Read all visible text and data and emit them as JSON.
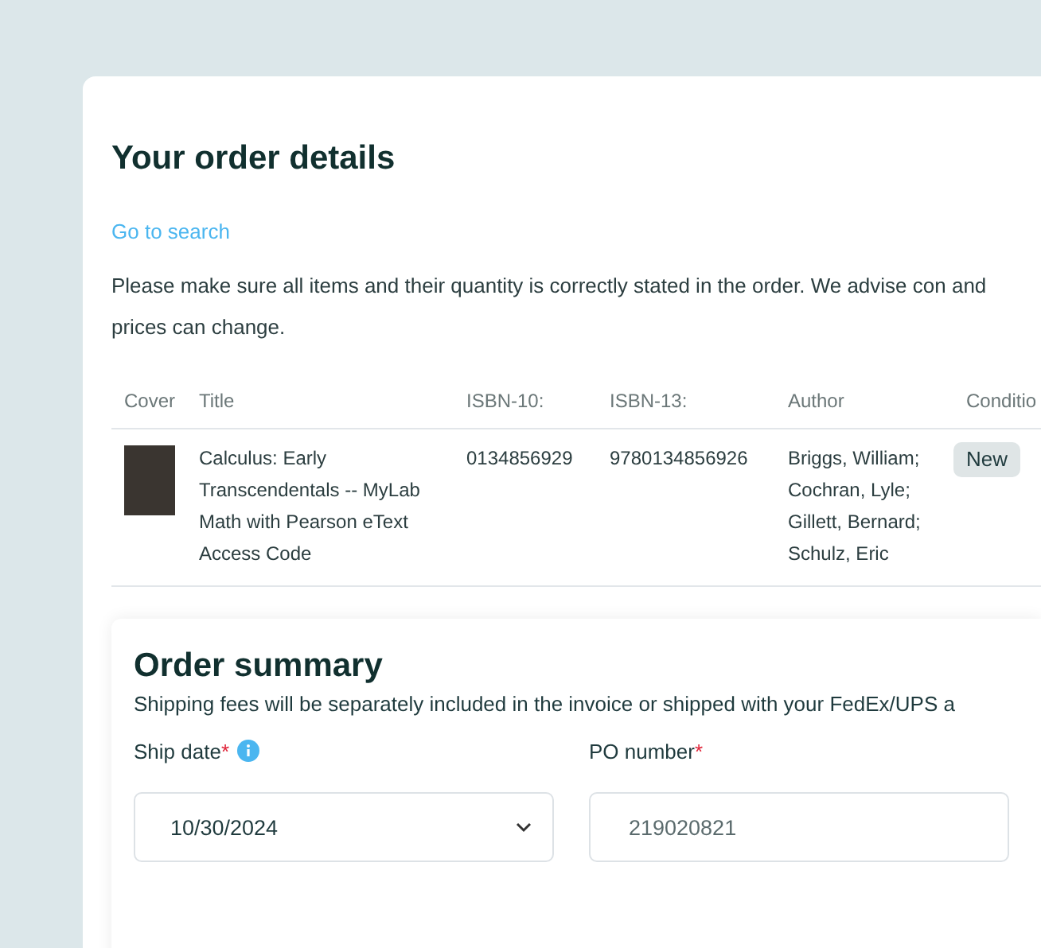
{
  "title": "Your order details",
  "link": "Go to search",
  "notice": "Please make sure all items and their quantity is correctly stated in the order. We advise con and prices can change.",
  "table": {
    "columns": [
      "Cover",
      "Title",
      "ISBN-10:",
      "ISBN-13:",
      "Author",
      "Conditio"
    ],
    "rows": [
      {
        "title": "Calculus: Early Transcendentals -- MyLab Math with Pearson eText Access Code",
        "isbn10": "0134856929",
        "isbn13": "9780134856926",
        "author": "Briggs, William; Cochran, Lyle; Gillett, Bernard; Schulz, Eric",
        "condition": "New"
      }
    ]
  },
  "summary": {
    "title": "Order summary",
    "note": "Shipping fees will be separately included in the invoice or shipped with your FedEx/UPS a",
    "fields": [
      {
        "kind": "select",
        "label": "Ship date",
        "required_mark": "*",
        "info": true,
        "value": "10/30/2024"
      },
      {
        "kind": "text",
        "label": "PO number",
        "required_mark": "*",
        "value": "219020821"
      }
    ]
  }
}
